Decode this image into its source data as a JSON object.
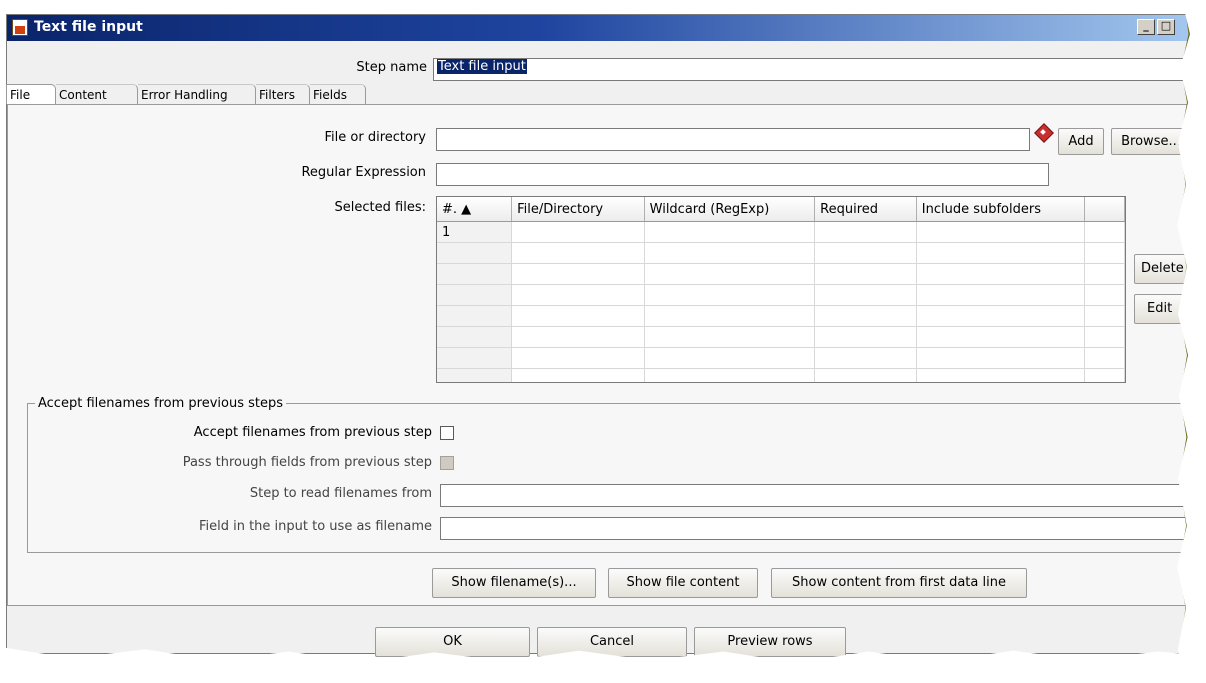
{
  "window": {
    "title": "Text file input",
    "minimize_label": "_",
    "restore_label": "□"
  },
  "step_name": {
    "label": "Step name",
    "value": "Text file input"
  },
  "tabs": [
    {
      "label": "File",
      "active": true
    },
    {
      "label": "Content",
      "active": false
    },
    {
      "label": "Error Handling",
      "active": false
    },
    {
      "label": "Filters",
      "active": false
    },
    {
      "label": "Fields",
      "active": false
    }
  ],
  "file_tab": {
    "file_or_directory_label": "File or directory",
    "file_or_directory_value": "",
    "add_button": "Add",
    "browse_button": "Browse...",
    "regex_label": "Regular Expression",
    "regex_value": "",
    "selected_files_label": "Selected files:",
    "delete_button": "Delete",
    "edit_button": "Edit",
    "table": {
      "columns": [
        "#. ▲",
        "File/Directory",
        "Wildcard (RegExp)",
        "Required",
        "Include subfolders",
        ""
      ],
      "rows": [
        [
          "1",
          "",
          "",
          "",
          "",
          ""
        ],
        [
          "",
          "",
          "",
          "",
          "",
          ""
        ],
        [
          "",
          "",
          "",
          "",
          "",
          ""
        ],
        [
          "",
          "",
          "",
          "",
          "",
          ""
        ],
        [
          "",
          "",
          "",
          "",
          "",
          ""
        ],
        [
          "",
          "",
          "",
          "",
          "",
          ""
        ],
        [
          "",
          "",
          "",
          "",
          "",
          ""
        ],
        [
          "",
          "",
          "",
          "",
          "",
          ""
        ]
      ]
    },
    "accept_group": {
      "legend": "Accept filenames from previous steps",
      "accept_label": "Accept filenames from previous step",
      "accept_checked": false,
      "pass_through_label": "Pass through fields from previous step",
      "pass_through_checked": false,
      "step_to_read_label": "Step to read filenames from",
      "step_to_read_value": "",
      "field_label": "Field in the input to use as filename",
      "field_value": ""
    },
    "show_filenames_button": "Show filename(s)...",
    "show_file_content_button": "Show file content",
    "show_content_first_line_button": "Show content from first data line"
  },
  "footer": {
    "ok_button": "OK",
    "cancel_button": "Cancel",
    "preview_button": "Preview rows"
  },
  "colors": {
    "title_bar": "#0a246a",
    "selection": "#0a246a",
    "torn_shadow": "#6b6a1c"
  }
}
